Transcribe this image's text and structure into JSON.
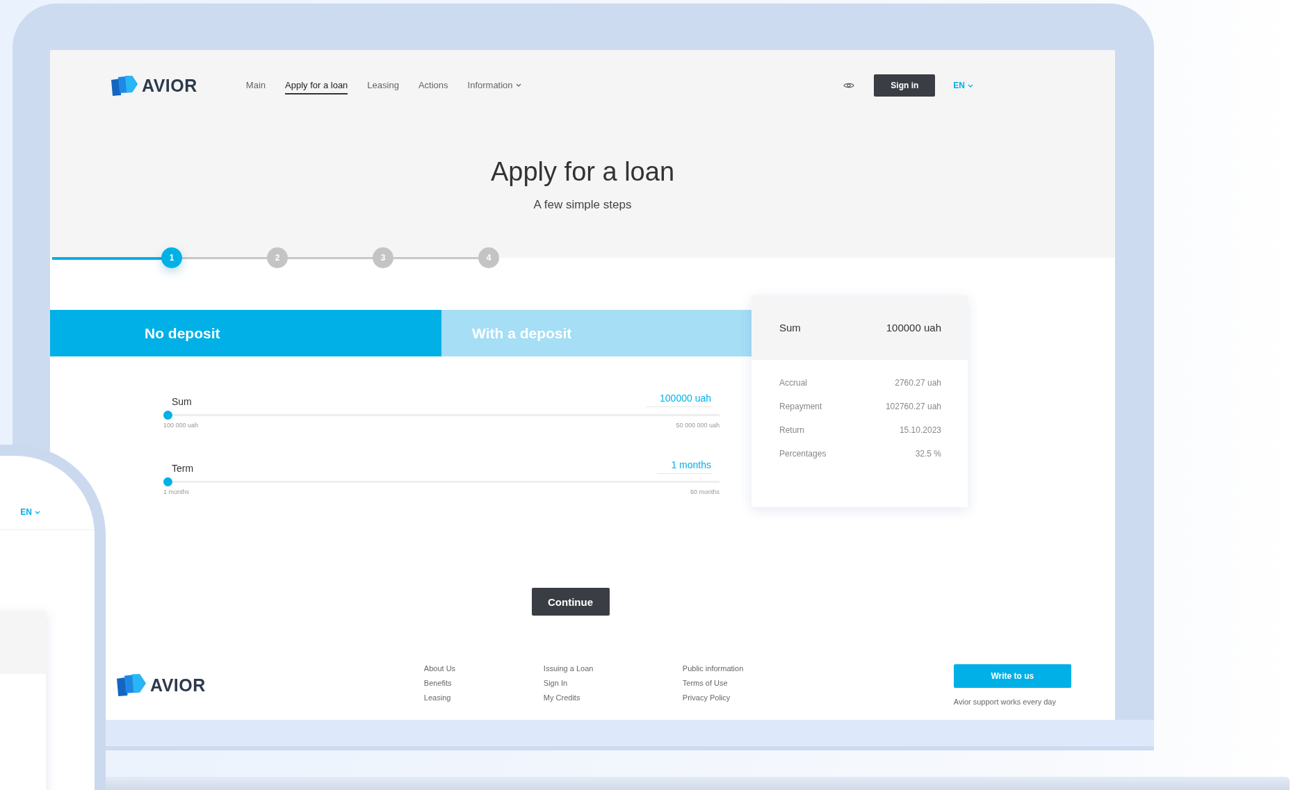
{
  "header": {
    "brand": "AVIOR",
    "nav": [
      {
        "label": "Main",
        "selected": false,
        "has_menu": false
      },
      {
        "label": "Apply for a loan",
        "selected": true,
        "has_menu": false
      },
      {
        "label": "Leasing",
        "selected": false,
        "has_menu": false
      },
      {
        "label": "Actions",
        "selected": false,
        "has_menu": false
      },
      {
        "label": "Information",
        "selected": false,
        "has_menu": true
      }
    ],
    "sign_in": "Sign in",
    "language": "EN"
  },
  "hero": {
    "title": "Apply for a loan",
    "subtitle": "A few simple steps"
  },
  "steps": [
    {
      "label": "1",
      "selected": true
    },
    {
      "label": "2",
      "selected": false
    },
    {
      "label": "3",
      "selected": false
    },
    {
      "label": "4",
      "selected": false
    }
  ],
  "tabs": [
    {
      "label": "No deposit",
      "selected": true
    },
    {
      "label": "With a deposit",
      "selected": false
    }
  ],
  "sliders": [
    {
      "label": "Sum",
      "value": "100000 uah",
      "level": 0,
      "min_label": "100 000 uah",
      "max_label": "50 000 000 uah"
    },
    {
      "label": "Term",
      "value": "1 months",
      "level": 0,
      "min_label": "1 months",
      "max_label": "60 months"
    }
  ],
  "summary": {
    "label": "Sum",
    "value": "100000 uah",
    "rows": [
      {
        "label": "Accrual",
        "value": "2760.27 uah"
      },
      {
        "label": "Repayment",
        "value": "102760.27 uah"
      },
      {
        "label": "Return",
        "value": "15.10.2023"
      },
      {
        "label": "Percentages",
        "value": "32.5 %"
      }
    ]
  },
  "continue_button": "Continue",
  "footer": {
    "brand": "AVIOR",
    "columns": [
      [
        "About Us",
        "Benefits",
        "Leasing"
      ],
      [
        "Issuing a Loan",
        "Sign In",
        "My Credits"
      ],
      [
        "Public information",
        "Terms of Use",
        "Privacy Policy"
      ]
    ],
    "button": "Write to us",
    "note": "Avior support works every day"
  },
  "phone": {
    "language": "EN"
  }
}
